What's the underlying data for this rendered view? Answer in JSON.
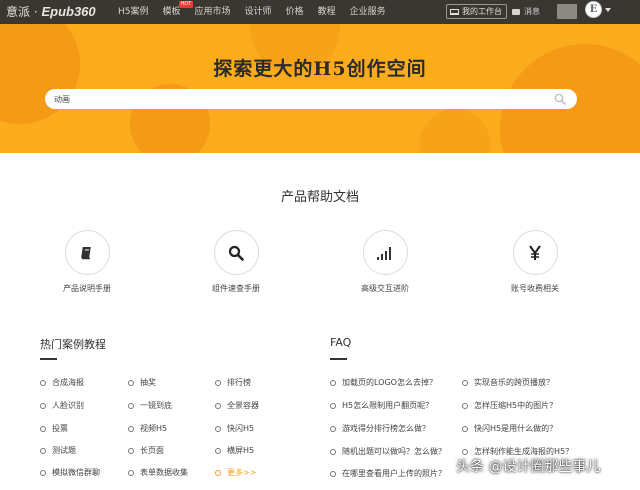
{
  "header": {
    "logo_text": "意派 · ",
    "logo_brand": "Epub360",
    "nav": [
      {
        "label": "H5案例"
      },
      {
        "label": "模板",
        "badge": "HOT"
      },
      {
        "label": "应用市场"
      },
      {
        "label": "设计师"
      },
      {
        "label": "价格"
      },
      {
        "label": "教程"
      },
      {
        "label": "企业服务"
      }
    ],
    "workspace_label": "我的工作台",
    "messages_label": "消息",
    "avatar_letter": "E"
  },
  "hero": {
    "title": "探索更大的H5创作空间",
    "search_value": "动画",
    "bg_color": "#fbac1c"
  },
  "help": {
    "title": "产品帮助文档",
    "items": [
      {
        "label": "产品说明手册",
        "icon": "book-icon"
      },
      {
        "label": "组件速查手册",
        "icon": "search-icon"
      },
      {
        "label": "高级交互进阶",
        "icon": "signal-bars-icon"
      },
      {
        "label": "账号收费相关",
        "icon": "yen-icon"
      }
    ]
  },
  "cases": {
    "title": "热门案例教程",
    "items": [
      "合成海报",
      "抽奖",
      "排行榜",
      "人脸识别",
      "一镜到底",
      "全景容器",
      "投票",
      "视频H5",
      "快闪H5",
      "测试题",
      "长页面",
      "横屏H5",
      "模拟微信群聊",
      "表单数据收集",
      "更多>>"
    ]
  },
  "faq": {
    "title": "FAQ",
    "items": [
      "加载页的LOGO怎么去掉？",
      "实现音乐的跨页播放？",
      "H5怎么限制用户翻页呢？",
      "怎样压缩H5中的图片？",
      "游戏得分排行榜怎么做？",
      "快闪H5是用什么做的？",
      "随机出题可以做吗？怎么做？",
      "怎样制作能生成海报的H5？",
      "在哪里查看用户上传的照片？"
    ]
  },
  "watermark": "头条 @设计圈那些事儿"
}
